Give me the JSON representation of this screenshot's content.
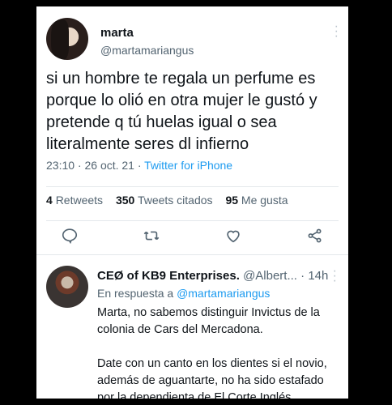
{
  "tweet": {
    "display_name": "marta",
    "handle": "@martamariangus",
    "text": "si un hombre te regala un perfume es porque lo olió en otra mujer le gustó y pretende q tú huelas igual o sea literalmente seres dl infierno",
    "time_date": "23:10 · 26 oct. 21 · ",
    "source": "Twitter for iPhone",
    "stats": {
      "retweets_count": "4",
      "retweets_label": "Retweets",
      "quotes_count": "350",
      "quotes_label": "Tweets citados",
      "likes_count": "95",
      "likes_label": "Me gusta"
    }
  },
  "reply": {
    "display_name": "CEØ of KB9 Enterprises.",
    "handle": "@Albert...",
    "time": " · 14h",
    "replying_prefix": "En respuesta a ",
    "replying_to": "@martamariangus",
    "paragraphs": [
      "Marta, no sabemos distinguir Invictus de la colonia de Cars del Mercadona.",
      "Date con un canto en los dientes si el novio, además de aguantarte, no ha sido estafado por la dependienta de El Corte Inglés."
    ]
  },
  "icons": [
    "reply-icon",
    "retweet-icon",
    "like-icon",
    "share-icon",
    "more-icon"
  ]
}
